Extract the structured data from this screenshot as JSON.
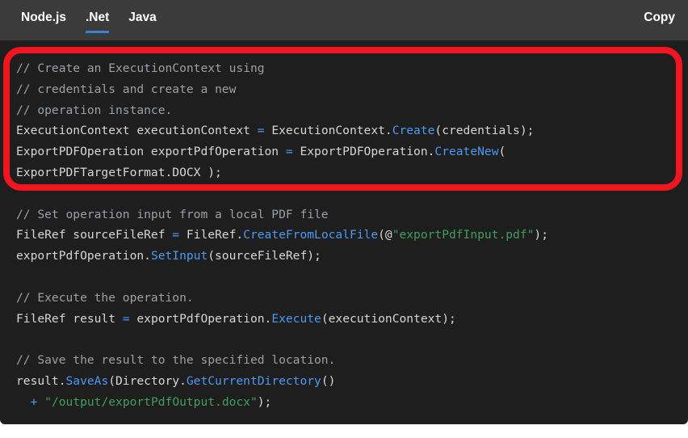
{
  "header": {
    "tabs": [
      {
        "label": "Node.js",
        "active": false
      },
      {
        "label": ".Net",
        "active": true
      },
      {
        "label": "Java",
        "active": false
      }
    ],
    "copy_label": "Copy",
    "active_tab_underline_color": "#3b82d6",
    "background_color": "#3b3b3b"
  },
  "annotation": {
    "shape": "rounded-rectangle",
    "color": "#f0151f",
    "border_width_px": 8,
    "covers_lines": [
      0,
      1,
      2,
      3,
      4,
      5
    ]
  },
  "code": {
    "language": ".Net",
    "background_color": "#1e1e1e",
    "colors": {
      "comment": "#9aa0a6",
      "plain": "#d6d6d6",
      "method": "#4c9af5",
      "operator": "#4c9af5",
      "string": "#3f9e5f"
    },
    "lines": [
      {
        "tokens": [
          {
            "t": "// Create an ExecutionContext using",
            "c": "cm"
          }
        ]
      },
      {
        "tokens": [
          {
            "t": "// credentials and create a new",
            "c": "cm"
          }
        ]
      },
      {
        "tokens": [
          {
            "t": "// operation instance.",
            "c": "cm"
          }
        ]
      },
      {
        "tokens": [
          {
            "t": "ExecutionContext executionContext ",
            "c": "pl"
          },
          {
            "t": "=",
            "c": "op"
          },
          {
            "t": " ExecutionContext.",
            "c": "pl"
          },
          {
            "t": "Create",
            "c": "fn"
          },
          {
            "t": "(credentials);",
            "c": "pl"
          }
        ]
      },
      {
        "tokens": [
          {
            "t": "ExportPDFOperation exportPdfOperation ",
            "c": "pl"
          },
          {
            "t": "=",
            "c": "op"
          },
          {
            "t": " ExportPDFOperation.",
            "c": "pl"
          },
          {
            "t": "CreateNew",
            "c": "fn"
          },
          {
            "t": "(",
            "c": "pl"
          }
        ]
      },
      {
        "tokens": [
          {
            "t": "ExportPDFTargetFormat.DOCX );",
            "c": "pl"
          }
        ]
      },
      {
        "tokens": [
          {
            "t": "",
            "c": "pl"
          }
        ]
      },
      {
        "tokens": [
          {
            "t": "// Set operation input from a local PDF file",
            "c": "cm"
          }
        ]
      },
      {
        "tokens": [
          {
            "t": "FileRef sourceFileRef ",
            "c": "pl"
          },
          {
            "t": "=",
            "c": "op"
          },
          {
            "t": " FileRef.",
            "c": "pl"
          },
          {
            "t": "CreateFromLocalFile",
            "c": "fn"
          },
          {
            "t": "(@",
            "c": "pl"
          },
          {
            "t": "\"exportPdfInput.pdf\"",
            "c": "st"
          },
          {
            "t": ");",
            "c": "pl"
          }
        ]
      },
      {
        "tokens": [
          {
            "t": "exportPdfOperation.",
            "c": "pl"
          },
          {
            "t": "SetInput",
            "c": "fn"
          },
          {
            "t": "(sourceFileRef);",
            "c": "pl"
          }
        ]
      },
      {
        "tokens": [
          {
            "t": "",
            "c": "pl"
          }
        ]
      },
      {
        "tokens": [
          {
            "t": "// Execute the operation.",
            "c": "cm"
          }
        ]
      },
      {
        "tokens": [
          {
            "t": "FileRef result ",
            "c": "pl"
          },
          {
            "t": "=",
            "c": "op"
          },
          {
            "t": " exportPdfOperation.",
            "c": "pl"
          },
          {
            "t": "Execute",
            "c": "fn"
          },
          {
            "t": "(executionContext);",
            "c": "pl"
          }
        ]
      },
      {
        "tokens": [
          {
            "t": "",
            "c": "pl"
          }
        ]
      },
      {
        "tokens": [
          {
            "t": "// Save the result to the specified location.",
            "c": "cm"
          }
        ]
      },
      {
        "tokens": [
          {
            "t": "result.",
            "c": "pl"
          },
          {
            "t": "SaveAs",
            "c": "fn"
          },
          {
            "t": "(Directory.",
            "c": "pl"
          },
          {
            "t": "GetCurrentDirectory",
            "c": "fn"
          },
          {
            "t": "()",
            "c": "pl"
          }
        ]
      },
      {
        "tokens": [
          {
            "t": "  ",
            "c": "pl"
          },
          {
            "t": "+",
            "c": "op"
          },
          {
            "t": " ",
            "c": "pl"
          },
          {
            "t": "\"/output/exportPdfOutput.docx\"",
            "c": "st"
          },
          {
            "t": ");",
            "c": "pl"
          }
        ]
      }
    ]
  }
}
